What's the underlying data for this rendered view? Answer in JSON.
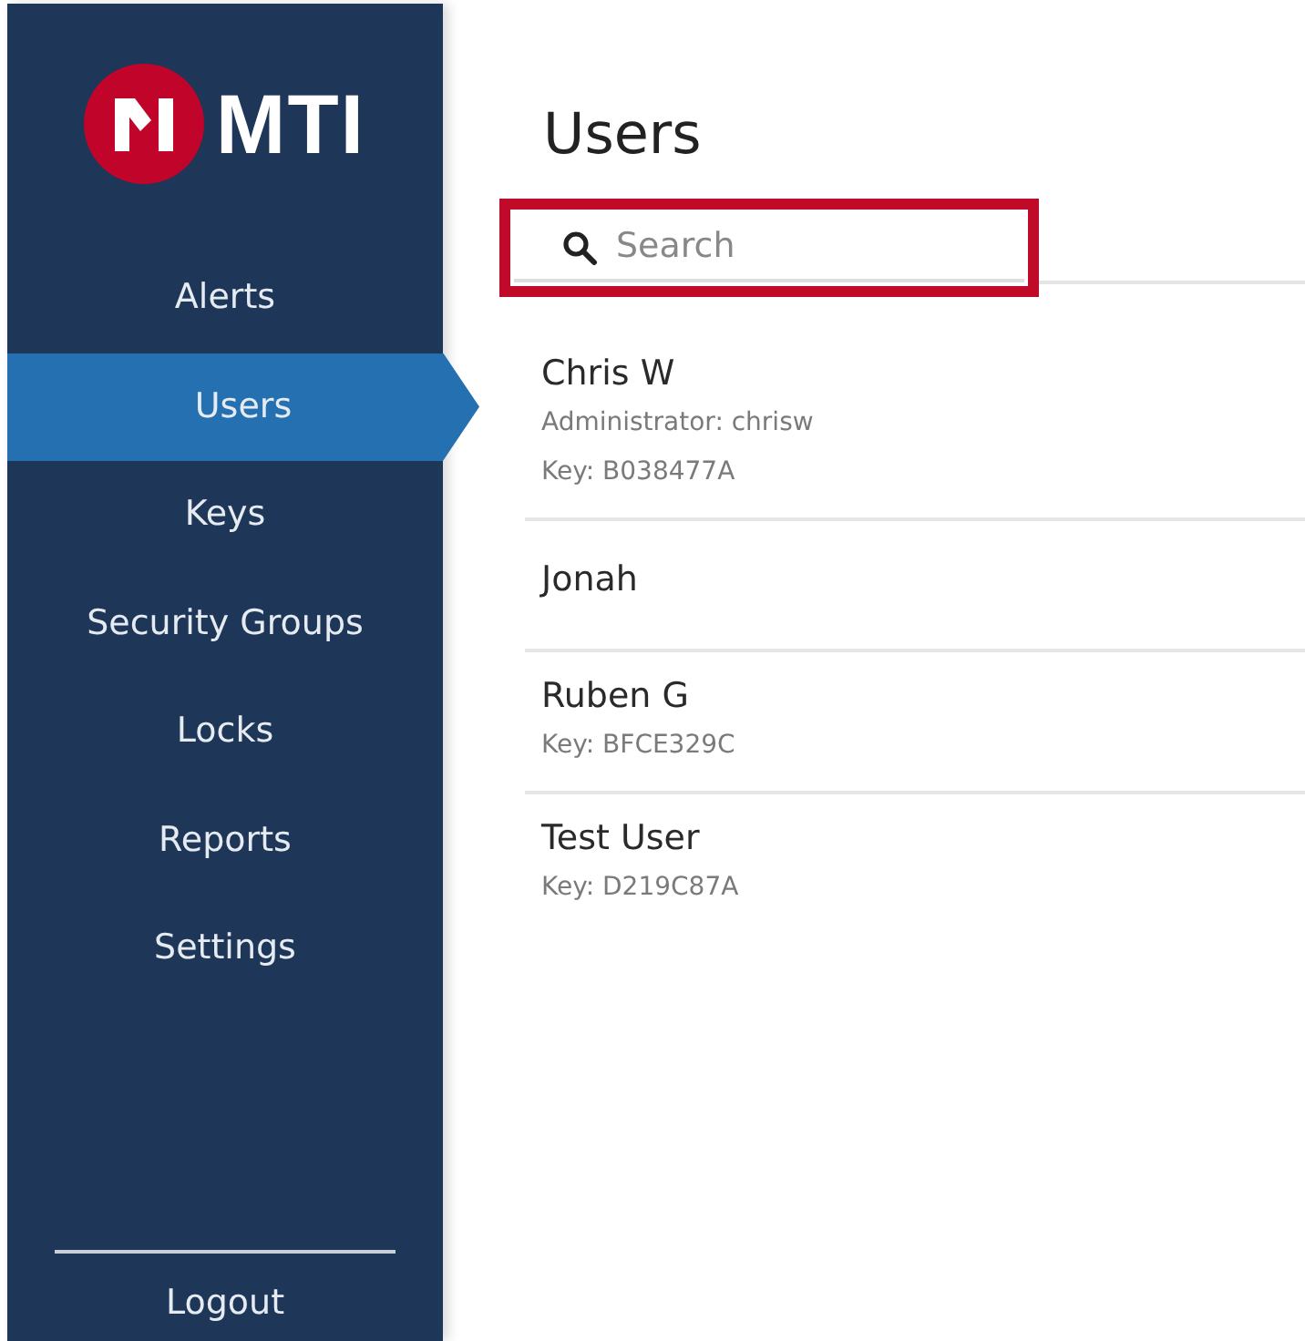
{
  "brand": "MTI",
  "nav": [
    {
      "label": "Alerts",
      "selected": false
    },
    {
      "label": "Users",
      "selected": true
    },
    {
      "label": "Keys",
      "selected": false
    },
    {
      "label": "Security Groups",
      "selected": false
    },
    {
      "label": "Locks",
      "selected": false
    },
    {
      "label": "Reports",
      "selected": false
    },
    {
      "label": "Settings",
      "selected": false
    }
  ],
  "logout": "Logout",
  "title": "Users",
  "search": {
    "placeholder": "Search"
  },
  "users": [
    {
      "name": "Chris W",
      "details": [
        "Administrator: chrisw",
        "Key: B038477A"
      ]
    },
    {
      "name": "Jonah"
    },
    {
      "name": "Ruben G",
      "details": [
        "Key: BFCE329C"
      ]
    },
    {
      "name": "Test User",
      "details": [
        "Key: D219C87A"
      ]
    }
  ]
}
